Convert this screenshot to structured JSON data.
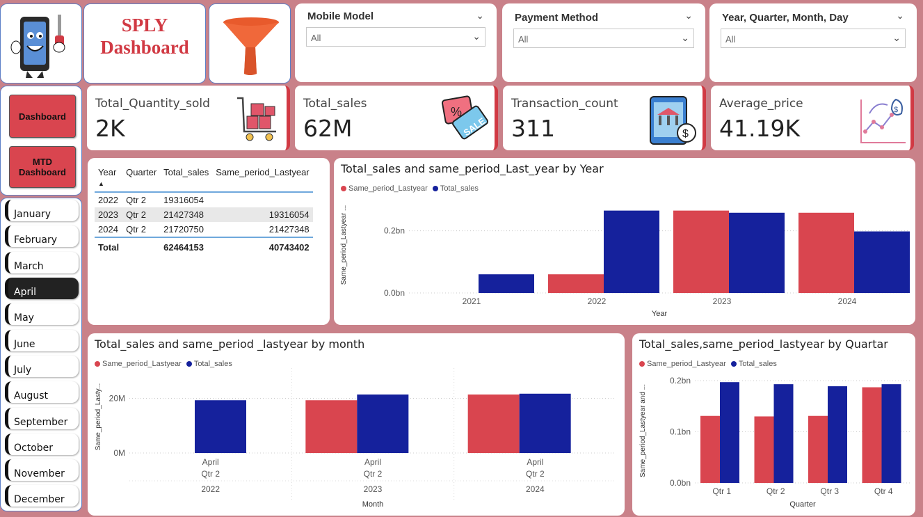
{
  "header": {
    "title_line1": "SPLY",
    "title_line2": "Dashboard"
  },
  "slicers": [
    {
      "label": "Mobile Model",
      "value": "All"
    },
    {
      "label": "Payment Method",
      "value": "All"
    },
    {
      "label": "Year, Quarter, Month, Day",
      "value": "All"
    }
  ],
  "nav": {
    "dashboard": "Dashboard",
    "mtd_line1": "MTD",
    "mtd_line2": "Dashboard"
  },
  "months": [
    "January",
    "February",
    "March",
    "April",
    "May",
    "June",
    "July",
    "August",
    "September",
    "October",
    "November",
    "December"
  ],
  "active_month": "April",
  "kpis": [
    {
      "label": "Total_Quantity_sold",
      "value": "2K",
      "icon": "shopping-cart-icon"
    },
    {
      "label": "Total_sales",
      "value": "62M",
      "icon": "sale-tag-icon"
    },
    {
      "label": "Transaction_count",
      "value": "311",
      "icon": "mobile-bank-icon"
    },
    {
      "label": "Average_price",
      "value": "41.19K",
      "icon": "growth-chart-icon"
    }
  ],
  "table": {
    "headers": [
      "Year",
      "Quarter",
      "Total_sales",
      "Same_period_Lastyear"
    ],
    "rows": [
      [
        "2022",
        "Qtr 2",
        "19316054",
        ""
      ],
      [
        "2023",
        "Qtr 2",
        "21427348",
        "19316054"
      ],
      [
        "2024",
        "Qtr 2",
        "21720750",
        "21427348"
      ]
    ],
    "total": [
      "Total",
      "",
      "62464153",
      "40743402"
    ]
  },
  "colors": {
    "same_period": "#d9454f",
    "total_sales": "#15219c",
    "accent": "#d13a44"
  },
  "chart_data": [
    {
      "type": "bar",
      "title": "Total_sales and same_period_Last_year by Year",
      "xlabel": "Year",
      "ylabel": "Same_period_Lastyear ...",
      "categories": [
        "2021",
        "2022",
        "2023",
        "2024"
      ],
      "series": [
        {
          "name": "Same_period_Lastyear",
          "values": [
            0,
            0.06,
            0.265,
            0.258
          ]
        },
        {
          "name": "Total_sales",
          "values": [
            0.06,
            0.265,
            0.258,
            0.198
          ]
        }
      ],
      "yticks": [
        "0.0bn",
        "0.2bn"
      ],
      "ylim": [
        0,
        0.3
      ],
      "legend": "top-left"
    },
    {
      "type": "bar",
      "title": "Total_sales and same_period _lastyear by month",
      "xlabel": "Month",
      "ylabel": "Same_period_Lasty...",
      "categories": [
        {
          "month": "April",
          "quarter": "Qtr 2",
          "year": "2022"
        },
        {
          "month": "April",
          "quarter": "Qtr 2",
          "year": "2023"
        },
        {
          "month": "April",
          "quarter": "Qtr 2",
          "year": "2024"
        }
      ],
      "series": [
        {
          "name": "Same_period_Lastyear",
          "values": [
            0,
            19316054,
            21427348
          ]
        },
        {
          "name": "Total_sales",
          "values": [
            19316054,
            21427348,
            21720750
          ]
        }
      ],
      "yticks": [
        "0M",
        "20M"
      ],
      "ylim": [
        0,
        26000000
      ],
      "legend": "top-left"
    },
    {
      "type": "bar",
      "title": "Total_sales,same_period_lastyear by Quartar",
      "xlabel": "Quarter",
      "ylabel": "Same_period_Lastyear and ...",
      "categories": [
        "Qtr 1",
        "Qtr 2",
        "Qtr 3",
        "Qtr 4"
      ],
      "series": [
        {
          "name": "Same_period_Lastyear",
          "values": [
            0.131,
            0.13,
            0.131,
            0.187
          ]
        },
        {
          "name": "Total_sales",
          "values": [
            0.197,
            0.193,
            0.189,
            0.193
          ]
        }
      ],
      "yticks": [
        "0.0bn",
        "0.1bn",
        "0.2bn"
      ],
      "ylim": [
        0,
        0.2
      ],
      "legend": "top-left"
    }
  ]
}
